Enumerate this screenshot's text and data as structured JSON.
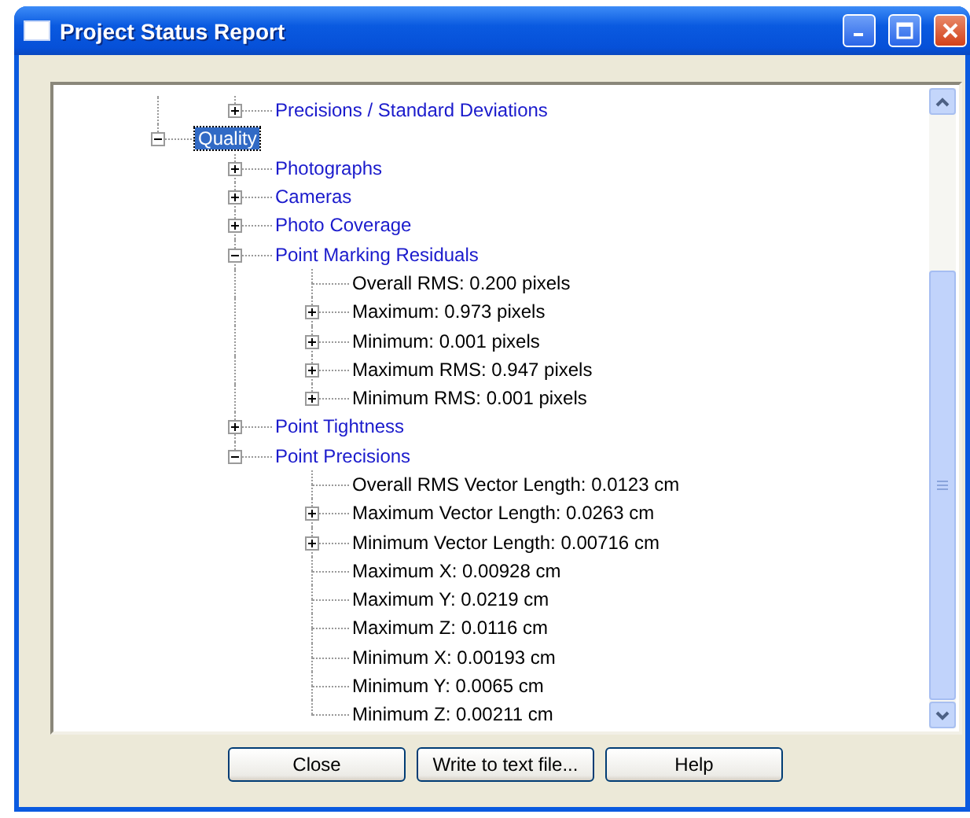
{
  "window": {
    "title": "Project Status Report"
  },
  "tree": {
    "cut_branch": [
      {
        "label": "Precisions / Standard Deviations",
        "expanded": false,
        "selected": false
      }
    ],
    "items": [
      {
        "label": "Quality",
        "expanded": true,
        "selected": true,
        "children": [
          {
            "label": "Photographs",
            "expanded": false,
            "selected": false
          },
          {
            "label": "Cameras",
            "expanded": false,
            "selected": false
          },
          {
            "label": "Photo Coverage",
            "expanded": false,
            "selected": false
          },
          {
            "label": "Point Marking Residuals",
            "expanded": true,
            "selected": false,
            "children": [
              {
                "label": "Overall RMS: 0.200 pixels",
                "selected": false
              },
              {
                "label": "Maximum: 0.973 pixels",
                "expanded": false,
                "selected": false
              },
              {
                "label": "Minimum: 0.001 pixels",
                "expanded": false,
                "selected": false
              },
              {
                "label": "Maximum RMS: 0.947 pixels",
                "expanded": false,
                "selected": false
              },
              {
                "label": "Minimum RMS: 0.001 pixels",
                "expanded": false,
                "selected": false
              }
            ]
          },
          {
            "label": "Point Tightness",
            "expanded": false,
            "selected": false
          },
          {
            "label": "Point Precisions",
            "expanded": true,
            "selected": false,
            "children": [
              {
                "label": "Overall RMS Vector Length: 0.0123 cm",
                "selected": false
              },
              {
                "label": "Maximum Vector Length: 0.0263 cm",
                "expanded": false,
                "selected": false
              },
              {
                "label": "Minimum Vector Length: 0.00716 cm",
                "expanded": false,
                "selected": false
              },
              {
                "label": "Maximum X: 0.00928 cm",
                "selected": false
              },
              {
                "label": "Maximum Y: 0.0219 cm",
                "selected": false
              },
              {
                "label": "Maximum Z: 0.0116 cm",
                "selected": false
              },
              {
                "label": "Minimum X: 0.00193 cm",
                "selected": false
              },
              {
                "label": "Minimum Y: 0.0065 cm",
                "selected": false
              },
              {
                "label": "Minimum Z: 0.00211 cm",
                "selected": false
              }
            ]
          }
        ]
      }
    ]
  },
  "buttons": [
    {
      "label": "Close"
    },
    {
      "label": "Write to text file..."
    },
    {
      "label": "Help"
    }
  ]
}
